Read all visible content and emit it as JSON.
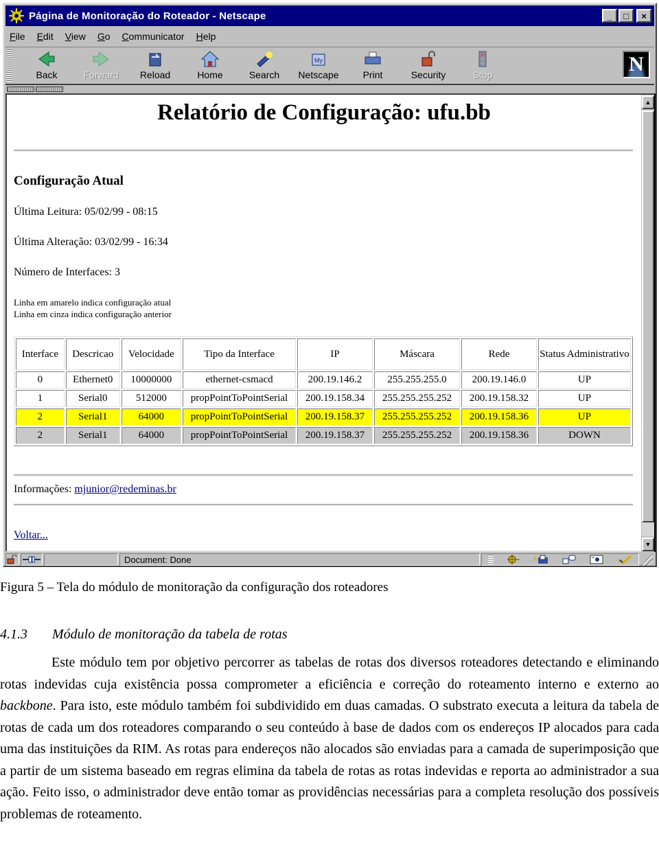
{
  "window": {
    "title": "Página de Monitoração do Roteador - Netscape",
    "controls": {
      "minimize": "_",
      "maximize": "□",
      "close": "×"
    }
  },
  "menu": [
    "File",
    "Edit",
    "View",
    "Go",
    "Communicator",
    "Help"
  ],
  "menu_accel": [
    "F",
    "E",
    "V",
    "G",
    "C",
    "H"
  ],
  "toolbar": {
    "buttons": [
      {
        "label": "Back",
        "icon": "back-arrow-icon",
        "enabled": true
      },
      {
        "label": "Forward",
        "icon": "forward-arrow-icon",
        "enabled": false
      },
      {
        "label": "Reload",
        "icon": "reload-icon",
        "enabled": true
      },
      {
        "label": "Home",
        "icon": "home-icon",
        "enabled": true
      },
      {
        "label": "Search",
        "icon": "search-flashlight-icon",
        "enabled": true
      },
      {
        "label": "Netscape",
        "icon": "my-netscape-icon",
        "enabled": true
      },
      {
        "label": "Print",
        "icon": "printer-icon",
        "enabled": true
      },
      {
        "label": "Security",
        "icon": "padlock-icon",
        "enabled": true
      },
      {
        "label": "Stop",
        "icon": "stop-light-icon",
        "enabled": false
      }
    ],
    "logo": "N"
  },
  "page": {
    "title": "Relatório de Configuração: ufu.bb",
    "section_heading": "Configuração Atual",
    "last_read": "Última Leitura: 05/02/99 - 08:15",
    "last_change": "Última Alteração: 03/02/99 - 16:34",
    "interface_count": "Número de Interfaces: 3",
    "legend_yellow": "Linha em amarelo indica configuração atual",
    "legend_gray": "Linha em cinza indica configuração anterior",
    "table": {
      "headers": [
        "Interface",
        "Descricao",
        "Velocidade",
        "Tipo da Interface",
        "IP",
        "Máscara",
        "Rede",
        "Status Administrativo"
      ],
      "rows": [
        {
          "state": "normal",
          "cells": [
            "0",
            "Ethernet0",
            "10000000",
            "ethernet-csmacd",
            "200.19.146.2",
            "255.255.255.0",
            "200.19.146.0",
            "UP"
          ]
        },
        {
          "state": "normal",
          "cells": [
            "1",
            "Serial0",
            "512000",
            "propPointToPointSerial",
            "200.19.158.34",
            "255.255.255.252",
            "200.19.158.32",
            "UP"
          ]
        },
        {
          "state": "current",
          "cells": [
            "2",
            "Serial1",
            "64000",
            "propPointToPointSerial",
            "200.19.158.37",
            "255.255.255.252",
            "200.19.158.36",
            "UP"
          ]
        },
        {
          "state": "previous",
          "cells": [
            "2",
            "Serial1",
            "64000",
            "propPointToPointSerial",
            "200.19.158.37",
            "255.255.255.252",
            "200.19.158.36",
            "DOWN"
          ]
        }
      ],
      "colors": {
        "current": "#ffff00",
        "previous": "#c8c8c8"
      }
    },
    "info_label": "Informações: ",
    "info_email": "mjunior@redeminas.br",
    "back_link": "Voltar..."
  },
  "statusbar": {
    "status_text": "Document: Done"
  },
  "document": {
    "caption": "Figura 5 – Tela do módulo de monitoração da configuração dos roteadores",
    "section_number": "4.1.3",
    "section_title": "Módulo de monitoração da tabela de rotas",
    "para_part1": "Este módulo tem por objetivo percorrer as tabelas de rotas dos diversos roteadores detectando e eliminando rotas indevidas cuja existência possa comprometer a eficiência e correção do roteamento interno e externo ao ",
    "para_italic": "backbone",
    "para_part2": ". Para isto, este módulo também foi subdividido em duas camadas. O substrato executa a leitura da tabela de rotas de cada um dos roteadores comparando o seu conteúdo à base de dados com os endereços IP alocados para cada uma das instituições da RIM. As rotas para endereços não alocados são enviadas para a camada de superimposição que a partir de um sistema baseado em regras elimina da tabela de rotas as rotas indevidas e reporta ao administrador a sua ação. Feito isso, o administrador deve então tomar as providências necessárias para a completa resolução dos possíveis problemas de roteamento."
  }
}
